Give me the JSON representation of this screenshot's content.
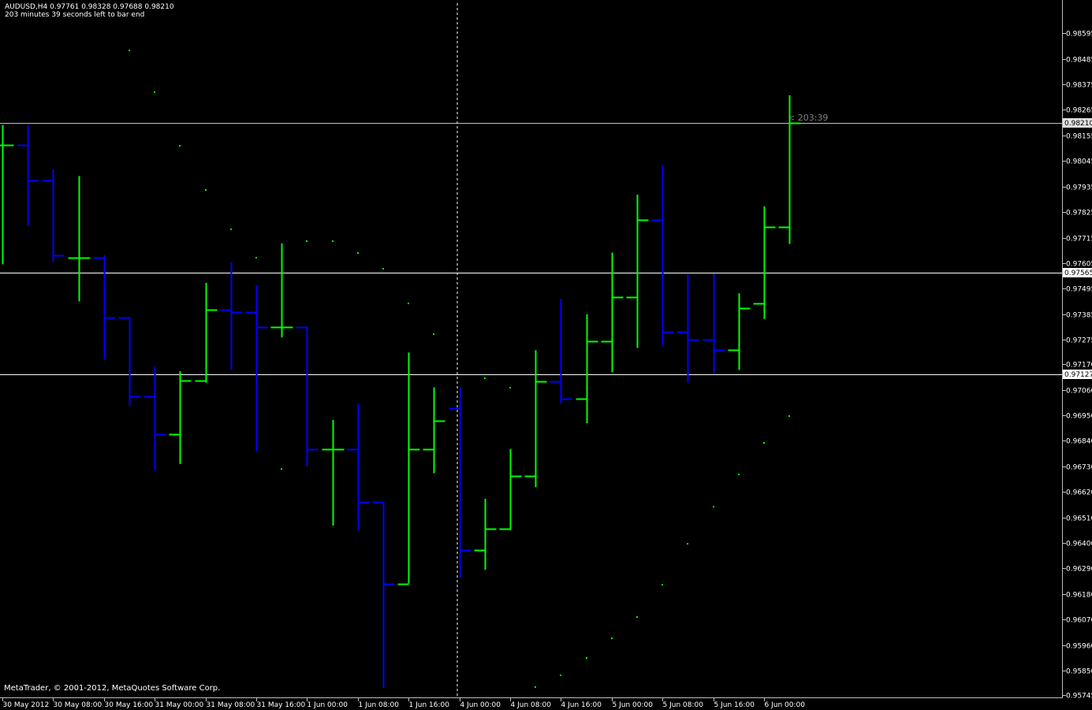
{
  "header": {
    "symbol_line": "AUDUSD,H4  0.97761 0.98328 0.97688 0.98210",
    "timer_line": "203 minutes 39 seconds left to bar end"
  },
  "footer": {
    "copyright": "MetaTrader, © 2001-2012, MetaQuotes Software Corp."
  },
  "chart_data": {
    "type": "bar",
    "symbol": "AUDUSD",
    "timeframe": "H4",
    "ylim": [
      0.95745,
      0.9865
    ],
    "y_ticks": [
      "0.98595",
      "0.98485",
      "0.98375",
      "0.98265",
      "0.98155",
      "0.98045",
      "0.97935",
      "0.97825",
      "0.97715",
      "0.97605",
      "0.97495",
      "0.97385",
      "0.97275",
      "0.97170",
      "0.97060",
      "0.96950",
      "0.96840",
      "0.96730",
      "0.96620",
      "0.96510",
      "0.96400",
      "0.96290",
      "0.96180",
      "0.96070",
      "0.95960",
      "0.95850",
      "0.95745"
    ],
    "x_ticks": [
      {
        "bar": 0,
        "label": "30 May 2012"
      },
      {
        "bar": 2,
        "label": "30 May 08:00"
      },
      {
        "bar": 4,
        "label": "30 May 16:00"
      },
      {
        "bar": 6,
        "label": "31 May 00:00"
      },
      {
        "bar": 8,
        "label": "31 May 08:00"
      },
      {
        "bar": 10,
        "label": "31 May 16:00"
      },
      {
        "bar": 12,
        "label": "1 Jun 00:00"
      },
      {
        "bar": 14,
        "label": "1 Jun 08:00"
      },
      {
        "bar": 16,
        "label": "1 Jun 16:00"
      },
      {
        "bar": 18,
        "label": "4 Jun 00:00"
      },
      {
        "bar": 20,
        "label": "4 Jun 08:00"
      },
      {
        "bar": 22,
        "label": "4 Jun 16:00"
      },
      {
        "bar": 24,
        "label": "5 Jun 00:00"
      },
      {
        "bar": 26,
        "label": "5 Jun 08:00"
      },
      {
        "bar": 28,
        "label": "5 Jun 16:00"
      },
      {
        "bar": 30,
        "label": "6 Jun 00:00"
      }
    ],
    "price_levels": [
      {
        "value": 0.9821,
        "label": "0.98210",
        "color": "#c0c0c0"
      },
      {
        "value": 0.97565,
        "label": "0.97565",
        "color": "#ffffff"
      },
      {
        "value": 0.97127,
        "label": "0.97127",
        "color": "#ffffff"
      }
    ],
    "bar_timer_label": "< 203:39",
    "up_color": "#00ff00",
    "down_color": "#0000ff",
    "ohlc": [
      {
        "o": 0.98115,
        "h": 0.982,
        "l": 0.976,
        "c": 0.98115
      },
      {
        "o": 0.98115,
        "h": 0.982,
        "l": 0.97765,
        "c": 0.9796
      },
      {
        "o": 0.9796,
        "h": 0.9801,
        "l": 0.9761,
        "c": 0.9764
      },
      {
        "o": 0.9763,
        "h": 0.9798,
        "l": 0.9744,
        "c": 0.9763
      },
      {
        "o": 0.9763,
        "h": 0.9764,
        "l": 0.9719,
        "c": 0.9737
      },
      {
        "o": 0.9737,
        "h": 0.9737,
        "l": 0.9699,
        "c": 0.9703
      },
      {
        "o": 0.9703,
        "h": 0.9716,
        "l": 0.9671,
        "c": 0.9687
      },
      {
        "o": 0.9687,
        "h": 0.9714,
        "l": 0.9674,
        "c": 0.971
      },
      {
        "o": 0.971,
        "h": 0.9752,
        "l": 0.9709,
        "c": 0.97405
      },
      {
        "o": 0.97405,
        "h": 0.9761,
        "l": 0.97145,
        "c": 0.97395
      },
      {
        "o": 0.97395,
        "h": 0.9751,
        "l": 0.96795,
        "c": 0.9733
      },
      {
        "o": 0.9733,
        "h": 0.9769,
        "l": 0.97285,
        "c": 0.9733
      },
      {
        "o": 0.9733,
        "h": 0.9733,
        "l": 0.9673,
        "c": 0.96805
      },
      {
        "o": 0.96805,
        "h": 0.9693,
        "l": 0.96475,
        "c": 0.96805
      },
      {
        "o": 0.96805,
        "h": 0.97,
        "l": 0.96455,
        "c": 0.96575
      },
      {
        "o": 0.96575,
        "h": 0.96575,
        "l": 0.95775,
        "c": 0.96225
      },
      {
        "o": 0.96225,
        "h": 0.9722,
        "l": 0.96225,
        "c": 0.96805
      },
      {
        "o": 0.96805,
        "h": 0.9707,
        "l": 0.967,
        "c": 0.96925
      },
      {
        "o": 0.9698,
        "h": 0.9707,
        "l": 0.9625,
        "c": 0.9637
      },
      {
        "o": 0.9637,
        "h": 0.9659,
        "l": 0.96285,
        "c": 0.9646
      },
      {
        "o": 0.9646,
        "h": 0.96805,
        "l": 0.96455,
        "c": 0.9669
      },
      {
        "o": 0.9669,
        "h": 0.9723,
        "l": 0.9664,
        "c": 0.97095
      },
      {
        "o": 0.97095,
        "h": 0.9745,
        "l": 0.97,
        "c": 0.9702
      },
      {
        "o": 0.9702,
        "h": 0.97385,
        "l": 0.96915,
        "c": 0.9727
      },
      {
        "o": 0.9727,
        "h": 0.9765,
        "l": 0.97135,
        "c": 0.9746
      },
      {
        "o": 0.9746,
        "h": 0.979,
        "l": 0.9724,
        "c": 0.9779
      },
      {
        "o": 0.9779,
        "h": 0.98025,
        "l": 0.9725,
        "c": 0.9731
      },
      {
        "o": 0.9731,
        "h": 0.97555,
        "l": 0.9709,
        "c": 0.97275
      },
      {
        "o": 0.97275,
        "h": 0.9756,
        "l": 0.9713,
        "c": 0.9723
      },
      {
        "o": 0.9723,
        "h": 0.97475,
        "l": 0.97145,
        "c": 0.9741
      },
      {
        "o": 0.9743,
        "h": 0.9785,
        "l": 0.97365,
        "c": 0.9776
      },
      {
        "o": 0.97761,
        "h": 0.98328,
        "l": 0.97688,
        "c": 0.9821
      }
    ],
    "parabolic_sar": [
      {
        "bar": 5,
        "value": 0.9852
      },
      {
        "bar": 6,
        "value": 0.9834
      },
      {
        "bar": 7,
        "value": 0.9811
      },
      {
        "bar": 8,
        "value": 0.9792
      },
      {
        "bar": 9,
        "value": 0.9775
      },
      {
        "bar": 10,
        "value": 0.9763
      },
      {
        "bar": 11,
        "value": 0.9672
      },
      {
        "bar": 12,
        "value": 0.977
      },
      {
        "bar": 13,
        "value": 0.977
      },
      {
        "bar": 14,
        "value": 0.9765
      },
      {
        "bar": 15,
        "value": 0.9758
      },
      {
        "bar": 16,
        "value": 0.9743
      },
      {
        "bar": 17,
        "value": 0.973
      },
      {
        "bar": 19,
        "value": 0.9711
      },
      {
        "bar": 20,
        "value": 0.9707
      },
      {
        "bar": 21,
        "value": 0.9578
      },
      {
        "bar": 22,
        "value": 0.9583
      },
      {
        "bar": 23,
        "value": 0.95905
      },
      {
        "bar": 24,
        "value": 0.9599
      },
      {
        "bar": 25,
        "value": 0.9608
      },
      {
        "bar": 26,
        "value": 0.9622
      },
      {
        "bar": 27,
        "value": 0.96395
      },
      {
        "bar": 28,
        "value": 0.96555
      },
      {
        "bar": 29,
        "value": 0.96695
      },
      {
        "bar": 30,
        "value": 0.9683
      },
      {
        "bar": 31,
        "value": 0.96945
      }
    ]
  }
}
